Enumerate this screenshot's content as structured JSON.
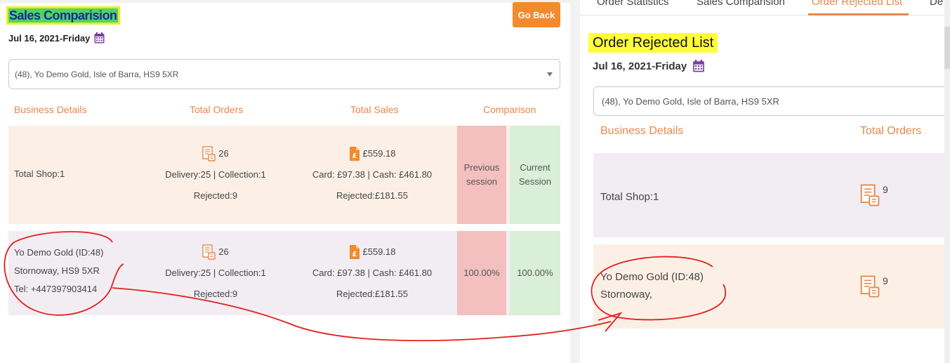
{
  "left": {
    "title": "Sales Comparision",
    "go_back_label": "Go Back",
    "date": "Jul 16, 2021-Friday",
    "store_select": "(48), Yo Demo Gold, Isle of Barra, HS9 5XR",
    "headers": [
      "Business Details",
      "Total Orders",
      "Total Sales",
      "Comparison"
    ],
    "rows": [
      {
        "details": [
          "Total Shop:1"
        ],
        "orders_count": "26",
        "orders_split": "Delivery:25 | Collection:1",
        "orders_rejected": "Rejected:9",
        "sales_total": "£559.18",
        "sales_split": "Card: £97.38 | Cash: £461.80",
        "sales_rejected": "Rejected:£181.55",
        "previous": "Previous session",
        "current": "Current Session"
      },
      {
        "details": [
          "Yo Demo Gold (ID:48)",
          "Stornoway, HS9 5XR",
          "Tel: +447397903414"
        ],
        "orders_count": "26",
        "orders_split": "Delivery:25 | Collection:1",
        "orders_rejected": "Rejected:9",
        "sales_total": "£559.18",
        "sales_split": "Card: £97.38 | Cash: £461.80",
        "sales_rejected": "Rejected:£181.55",
        "previous": "100.00%",
        "current": "100.00%"
      }
    ]
  },
  "right": {
    "tabs": [
      "Order Statistics",
      "Sales Comparision",
      "Order Rejected List",
      "De"
    ],
    "active_tab": "Order Rejected List",
    "title": "Order Rejected List",
    "date": "Jul 16, 2021-Friday",
    "store_select": "(48), Yo Demo Gold, Isle of Barra, HS9 5XR",
    "headers": [
      "Business Details",
      "Total Orders"
    ],
    "rows": [
      {
        "details": [
          "Total Shop:1"
        ],
        "orders": "9"
      },
      {
        "details": [
          "Yo Demo Gold (ID:48)",
          "Stornoway,"
        ],
        "orders": "9"
      }
    ]
  },
  "icons": {
    "calendar": "calendar-icon",
    "orders": "order-list-icon",
    "sales": "pound-sales-icon"
  },
  "colors": {
    "accent": "#e8874b",
    "go_back": "#f28a2e",
    "calendar": "#7b3fa0",
    "highlight": "#ffff3a",
    "annotation": "#e02020"
  }
}
